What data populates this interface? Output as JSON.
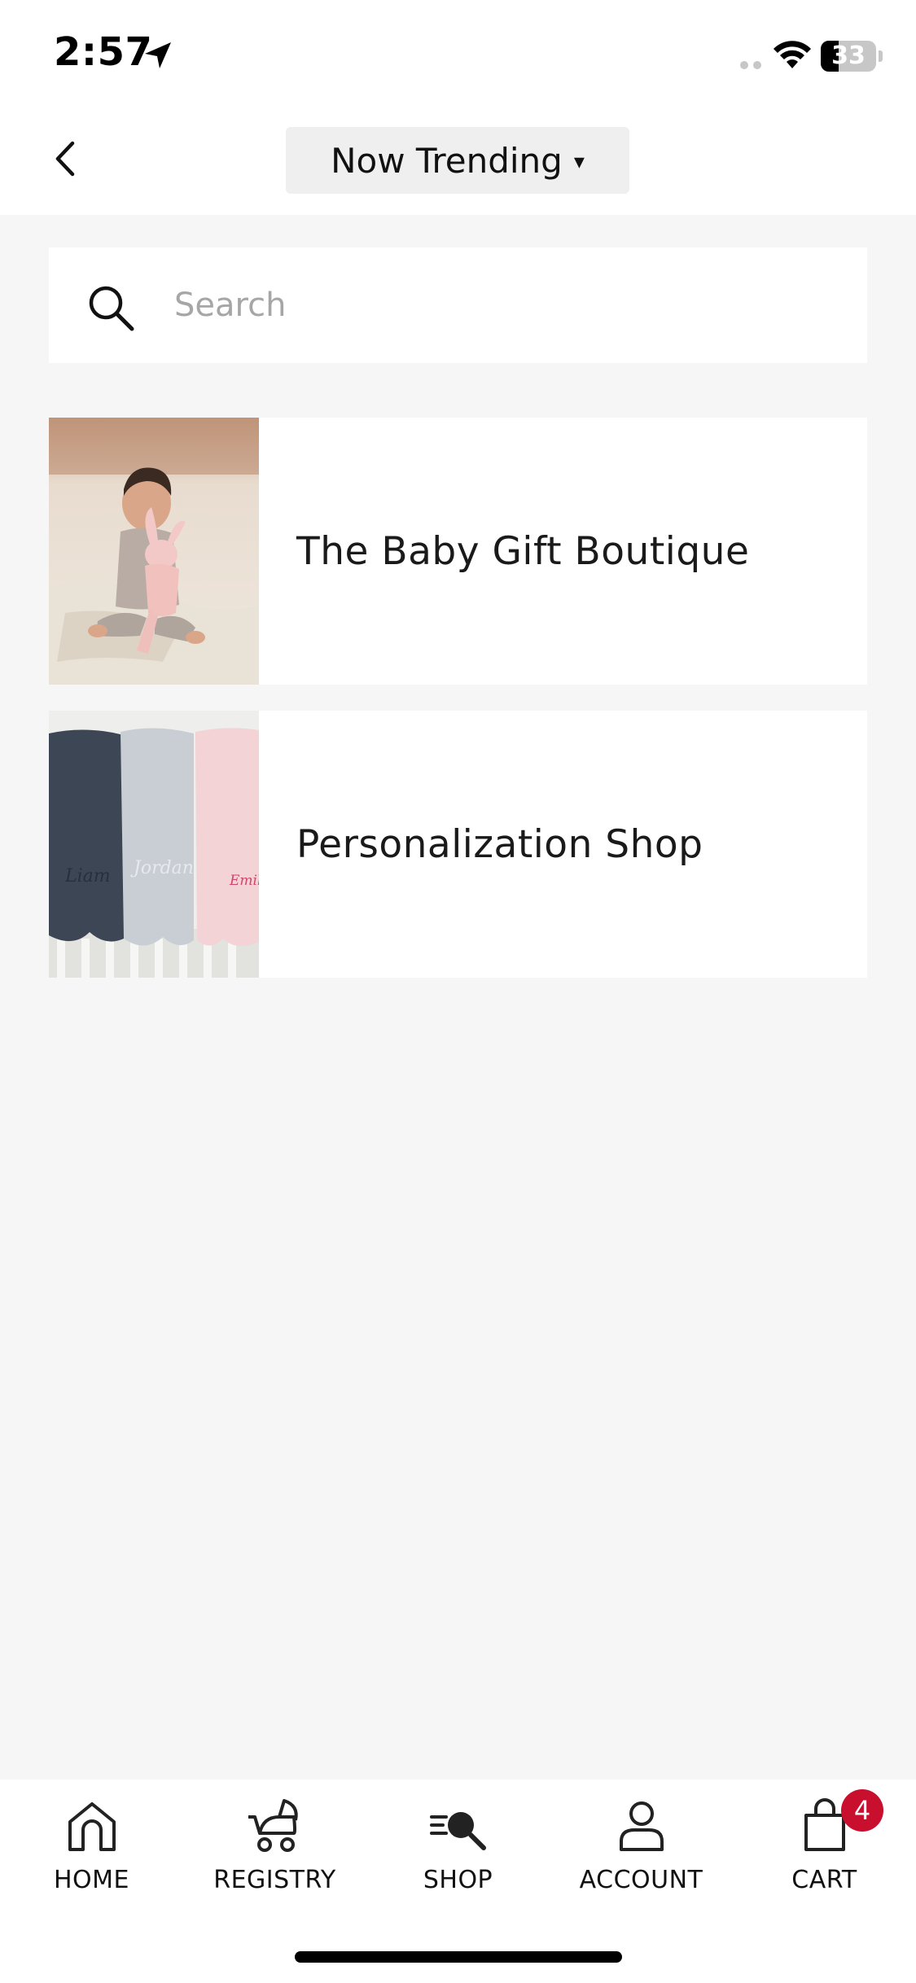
{
  "status_bar": {
    "time": "2:57",
    "battery_level": "33",
    "battery_fraction": 0.33
  },
  "header": {
    "title": "Now Trending",
    "caret": "▾"
  },
  "search": {
    "placeholder": "Search",
    "value": ""
  },
  "categories": [
    {
      "label": "The Baby Gift Boutique",
      "image": "baby-with-bunny-photo"
    },
    {
      "label": "Personalization Shop",
      "image": "personalized-blankets-photo",
      "blanket_names": [
        "Liam",
        "Jordan",
        "Emil"
      ]
    }
  ],
  "tabs": [
    {
      "label": "HOME",
      "icon": "home-icon"
    },
    {
      "label": "REGISTRY",
      "icon": "stroller-icon"
    },
    {
      "label": "SHOP",
      "icon": "shop-search-icon"
    },
    {
      "label": "ACCOUNT",
      "icon": "account-icon"
    },
    {
      "label": "CART",
      "icon": "cart-bag-icon"
    }
  ],
  "cart_badge": "4",
  "colors": {
    "background": "#f6f6f6",
    "surface": "#ffffff",
    "badge": "#c8102e",
    "placeholder": "#a6a6a6"
  }
}
